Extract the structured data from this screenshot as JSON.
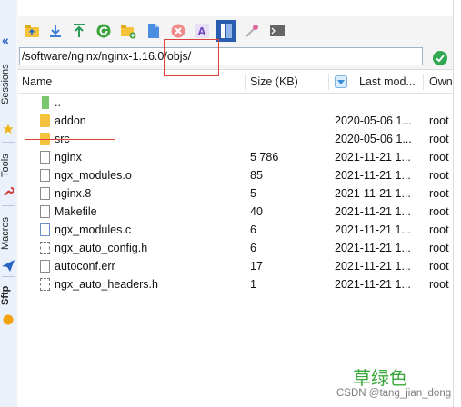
{
  "side_tabs": [
    {
      "label": "Sessions",
      "icon": "star-icon",
      "icon_color": "#f1b51c"
    },
    {
      "label": "Tools",
      "icon": "wrench-icon",
      "icon_color": "#d23a3a"
    },
    {
      "label": "Macros",
      "icon": "paper-plane-icon",
      "icon_color": "#2a64c2"
    },
    {
      "label": "Sftp",
      "icon": "orange-dot-icon",
      "icon_color": "#f2a30f"
    }
  ],
  "toolbar": {
    "buttons": [
      {
        "name": "go-up-folder-icon",
        "color": "#f4c23b"
      },
      {
        "name": "download-icon",
        "color": "#3c7fd6"
      },
      {
        "name": "upload-icon",
        "color": "#2c9b57"
      },
      {
        "name": "refresh-icon",
        "color": "#3ea33e"
      },
      {
        "name": "new-folder-icon",
        "color": "#f4c23b"
      },
      {
        "name": "new-file-icon",
        "color": "#4b8ee2"
      },
      {
        "name": "delete-icon",
        "color": "#e04848"
      },
      {
        "name": "rename-icon",
        "color": "#6a3fbf"
      },
      {
        "name": "permissions-icon",
        "color": "#2a5db0"
      },
      {
        "name": "properties-icon",
        "color": "#e06aa0"
      },
      {
        "name": "terminal-icon",
        "color": "#555555"
      }
    ]
  },
  "path": {
    "value": "/software/nginx/nginx-1.16.0/objs/"
  },
  "columns": {
    "name": "Name",
    "size": "Size (KB)",
    "modified": "Last mod...",
    "owner": "Own"
  },
  "files": [
    {
      "icon": "parent-folder-icon",
      "name": "..",
      "size": "",
      "date": "",
      "owner": ""
    },
    {
      "icon": "folder-icon",
      "name": "addon",
      "size": "",
      "date": "2020-05-06 1...",
      "owner": "root"
    },
    {
      "icon": "folder-icon",
      "name": "src",
      "size": "",
      "date": "2020-05-06 1...",
      "owner": "root"
    },
    {
      "icon": "file-icon",
      "name": "nginx",
      "size": "5 786",
      "date": "2021-11-21 1...",
      "owner": "root"
    },
    {
      "icon": "file-icon",
      "name": "ngx_modules.o",
      "size": "85",
      "date": "2021-11-21 1...",
      "owner": "root"
    },
    {
      "icon": "file-icon",
      "name": "nginx.8",
      "size": "5",
      "date": "2021-11-21 1...",
      "owner": "root"
    },
    {
      "icon": "file-icon",
      "name": "Makefile",
      "size": "40",
      "date": "2021-11-21 1...",
      "owner": "root"
    },
    {
      "icon": "c-file-icon",
      "name": "ngx_modules.c",
      "size": "6",
      "date": "2021-11-21 1...",
      "owner": "root"
    },
    {
      "icon": "h-file-icon",
      "name": "ngx_auto_config.h",
      "size": "6",
      "date": "2021-11-21 1...",
      "owner": "root"
    },
    {
      "icon": "file-icon",
      "name": "autoconf.err",
      "size": "17",
      "date": "2021-11-21 1...",
      "owner": "root"
    },
    {
      "icon": "h-file-icon",
      "name": "ngx_auto_headers.h",
      "size": "1",
      "date": "2021-11-21 1...",
      "owner": "root"
    }
  ],
  "watermark": {
    "chinese": "草绿色",
    "csdn": "CSDN @tang_jian_dong"
  },
  "annotation_color": "#e0403a"
}
